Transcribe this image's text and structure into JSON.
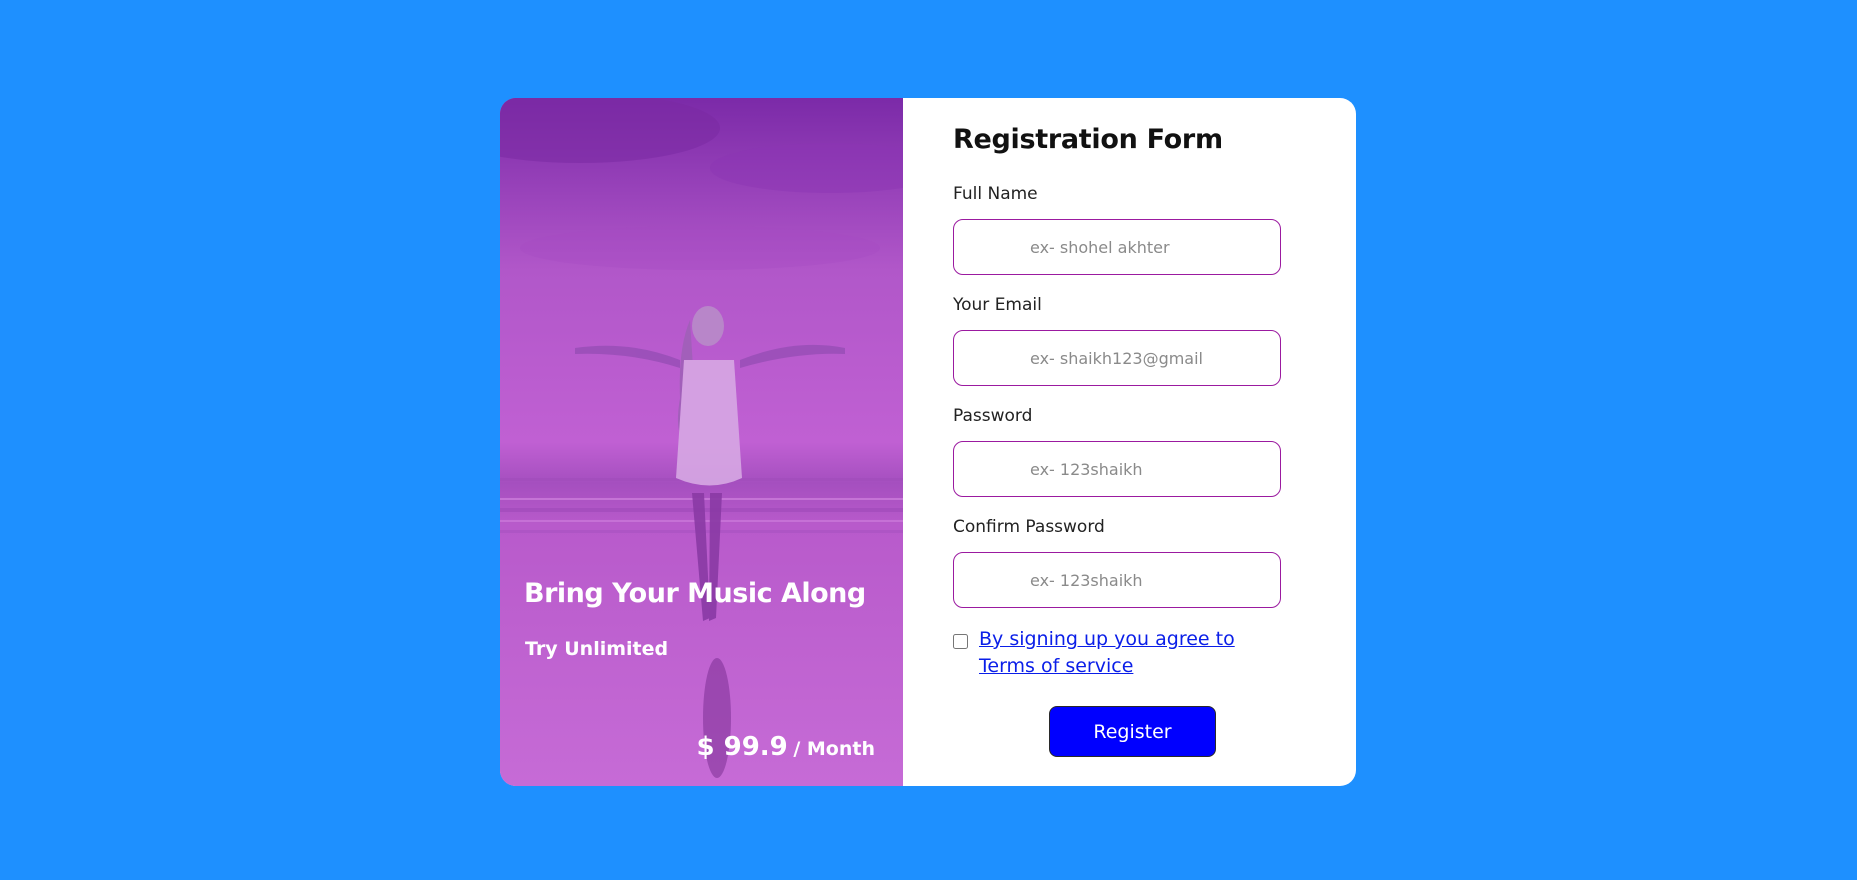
{
  "colors": {
    "page_background": "#1e90ff",
    "hero_tint": "#c35fd4",
    "input_border": "#9b1aa0",
    "link": "#0a1ee8",
    "button": "#0000ff"
  },
  "hero": {
    "image": "woman-on-beach-photo",
    "title": "Bring Your Music Along",
    "subtitle": "Try Unlimited",
    "price_amount": "$ 99.9",
    "price_unit": "/ Month"
  },
  "form": {
    "title": "Registration Form",
    "fields": [
      {
        "label": "Full Name",
        "placeholder": "ex- shohel akhter",
        "value": ""
      },
      {
        "label": "Your Email",
        "placeholder": "ex- shaikh123@gmail",
        "value": ""
      },
      {
        "label": "Password",
        "placeholder": "ex- 123shaikh",
        "value": ""
      },
      {
        "label": "Confirm Password",
        "placeholder": "ex- 123shaikh",
        "value": ""
      }
    ],
    "terms_checked": false,
    "terms_text": "By signing up you agree to Terms of service",
    "register_label": "Register"
  }
}
